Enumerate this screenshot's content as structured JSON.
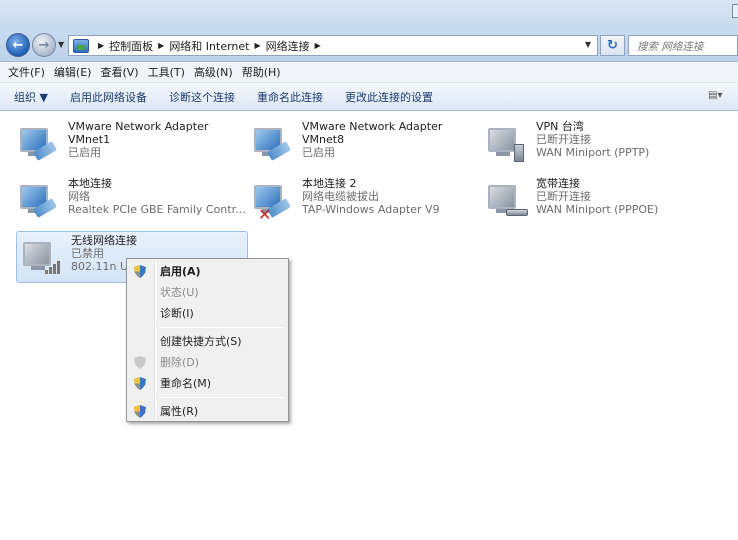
{
  "address": {
    "crumbs": [
      "控制面板",
      "网络和 Internet",
      "网络连接"
    ],
    "search_placeholder": "搜索 网络连接"
  },
  "menubar": {
    "items": [
      "文件(F)",
      "编辑(E)",
      "查看(V)",
      "工具(T)",
      "高级(N)",
      "帮助(H)"
    ]
  },
  "commandbar": {
    "items": [
      "组织 ▼",
      "启用此网络设备",
      "诊断这个连接",
      "重命名此连接",
      "更改此连接的设置"
    ]
  },
  "connections": [
    {
      "name": "VMware Network Adapter",
      "line2": "VMnet1",
      "line3": "已启用",
      "icon": "network-adapter-icon"
    },
    {
      "name": "VMware Network Adapter",
      "line2": "VMnet8",
      "line3": "已启用",
      "icon": "network-adapter-icon"
    },
    {
      "name": "VPN 台湾",
      "line2": "已断开连接",
      "line3": "WAN Miniport (PPTP)",
      "icon": "vpn-connection-icon"
    },
    {
      "name": "本地连接",
      "line2": "网络",
      "line3": "Realtek PCIe GBE Family Contr...",
      "icon": "network-adapter-icon"
    },
    {
      "name": "本地连接 2",
      "line2": "网络电缆被拔出",
      "line3": "TAP-Windows Adapter V9",
      "icon": "disconnected-adapter-icon"
    },
    {
      "name": "宽带连接",
      "line2": "已断开连接",
      "line3": "WAN Miniport (PPPOE)",
      "icon": "broadband-connection-icon"
    },
    {
      "name": "无线网络连接",
      "line2": "已禁用",
      "line3": "802.11n USB",
      "icon": "wireless-adapter-icon"
    }
  ],
  "context_menu": {
    "items": [
      {
        "label": "启用(A)",
        "bold": true,
        "disabled": false,
        "shield": true
      },
      {
        "label": "状态(U)",
        "bold": false,
        "disabled": true,
        "shield": false
      },
      {
        "label": "诊断(I)",
        "bold": false,
        "disabled": false,
        "shield": false
      },
      {
        "label": "创建快捷方式(S)",
        "bold": false,
        "disabled": false,
        "shield": false
      },
      {
        "label": "删除(D)",
        "bold": false,
        "disabled": true,
        "shield": true
      },
      {
        "label": "重命名(M)",
        "bold": false,
        "disabled": false,
        "shield": true
      },
      {
        "label": "属性(R)",
        "bold": false,
        "disabled": false,
        "shield": true
      }
    ]
  },
  "colors": {
    "accent": "#1f5fb5",
    "selection": "#d2e4f7",
    "disconnected": "#d42020"
  }
}
